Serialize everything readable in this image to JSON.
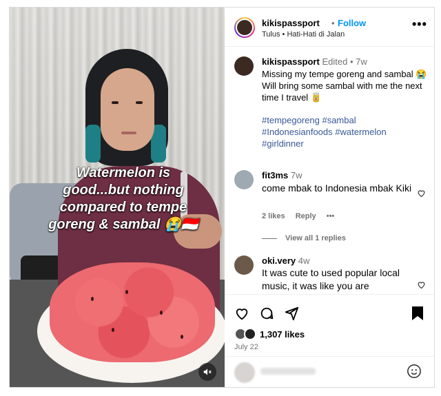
{
  "media": {
    "overlay_lines": [
      "Watermelon is",
      "good...but nothing",
      "compared to tempe",
      "goreng & sambal 😭🇮🇩"
    ],
    "mute_icon": "speaker-muted-icon"
  },
  "header": {
    "username": "kikispassport",
    "separator": "•",
    "follow_label": "Follow",
    "music": "Tulus • Hati-Hati di Jalan",
    "more_label": "•••"
  },
  "caption": {
    "username": "kikispassport",
    "edited": "Edited",
    "dot": "•",
    "time": "7w",
    "text": "Missing my tempe goreng and sambal 😭 Will bring some sambal with me the next time I travel 🥫",
    "hashtags": [
      "#tempegoreng",
      "#sambal",
      "#Indonesianfoods",
      "#watermelon",
      "#girldinner"
    ]
  },
  "comments": [
    {
      "username": "fit3ms",
      "time": "7w",
      "text": "come mbak to Indonesia mbak Kiki",
      "likes": "2 likes",
      "reply": "Reply",
      "more": "•••",
      "view_replies": "View all 1 replies"
    },
    {
      "username": "oki.very",
      "time": "4w",
      "text": "It was cute to used popular local music, it was like you are"
    }
  ],
  "actions": {
    "like_icon": "heart-icon",
    "comment_icon": "comment-icon",
    "share_icon": "share-icon",
    "save_icon": "bookmark-icon",
    "likes": "1,307 likes",
    "date": "July 22"
  },
  "colors": {
    "accent": "#0095f6",
    "hashtag": "#385898",
    "muted": "#737373"
  }
}
